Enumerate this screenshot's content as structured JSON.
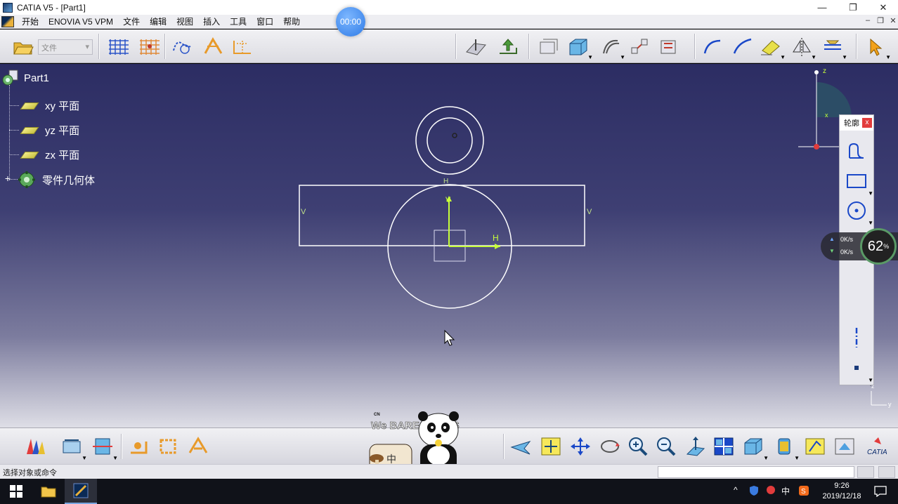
{
  "window": {
    "title": "CATIA V5 - [Part1]",
    "minimize": "—",
    "restore": "❐",
    "close": "✕"
  },
  "menu": {
    "items": [
      "开始",
      "ENOVIA V5 VPM",
      "文件",
      "编辑",
      "视图",
      "插入",
      "工具",
      "窗口",
      "帮助"
    ],
    "mdi_min": "–",
    "mdi_restore": "❐",
    "mdi_close": "✕"
  },
  "toolbar": {
    "file_combo": "文件"
  },
  "timer": "00:00",
  "tree": {
    "root": "Part1",
    "items": [
      "xy 平面",
      "yz 平面",
      "zx 平面",
      "零件几何体"
    ],
    "expand": "+"
  },
  "sketch": {
    "constraint_h_top": "H",
    "constraint_v_left": "V",
    "constraint_v_right": "V",
    "constraint_v_center": "V",
    "axis_h": "H"
  },
  "compass": {
    "z_label": "z",
    "x_label": "x"
  },
  "corner_axis": {
    "z_label": "z",
    "y_label": "y"
  },
  "palette": {
    "title": "轮廓",
    "close": "x"
  },
  "speed_widget": {
    "up": "0K/s",
    "down": "0K/s",
    "percent": "62",
    "percent_unit": "%"
  },
  "mascot": {
    "brand_small": "CN",
    "brand": "We BARE BEARS",
    "badge": "中"
  },
  "status": {
    "prompt": "选择对象或命令"
  },
  "taskbar": {
    "time": "9:26",
    "date": "2019/12/18",
    "ime": "中"
  },
  "colors": {
    "workspace_top": "#2c2d63",
    "sketch_line": "#ffffff",
    "axis_green": "#c7ff3a",
    "accent_red": "#e23c3c"
  }
}
